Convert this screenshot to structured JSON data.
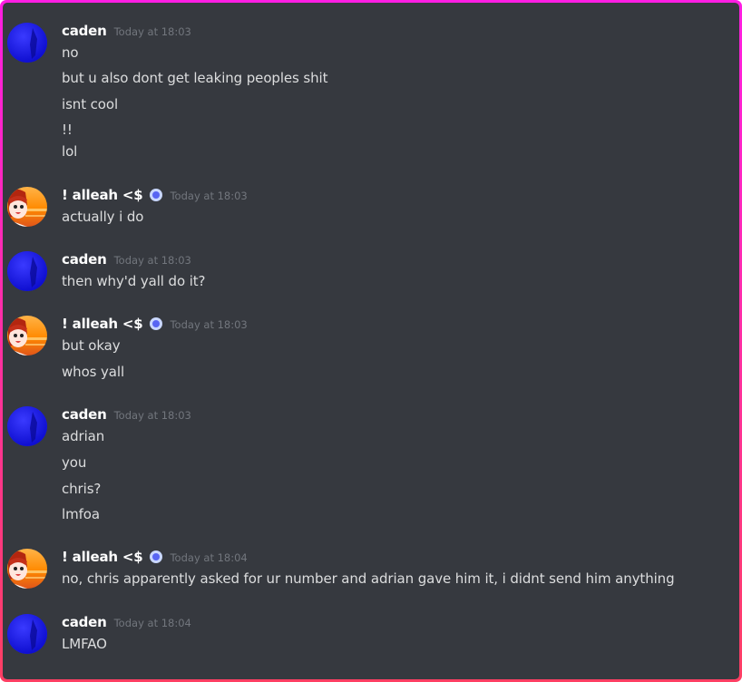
{
  "messages": [
    {
      "author": "caden",
      "timestamp": "Today at 18:03",
      "avatar": "blue-avatar",
      "lines": [
        "no",
        "but u also dont get leaking peoples shit",
        "isnt cool",
        "!!",
        "lol"
      ]
    },
    {
      "author": "! alleah <$",
      "timestamp": "Today at 18:03",
      "avatar": "anime-avatar",
      "badge": "status-badge-icon",
      "lines": [
        "actually i do"
      ]
    },
    {
      "author": "caden",
      "timestamp": "Today at 18:03",
      "avatar": "blue-avatar",
      "lines": [
        "then why'd yall do it?"
      ]
    },
    {
      "author": "! alleah <$",
      "timestamp": "Today at 18:03",
      "avatar": "anime-avatar",
      "badge": "status-badge-icon",
      "lines": [
        "but okay",
        "whos yall"
      ]
    },
    {
      "author": "caden",
      "timestamp": "Today at 18:03",
      "avatar": "blue-avatar",
      "lines": [
        "adrian",
        "you",
        "chris?",
        "lmfoa"
      ]
    },
    {
      "author": "! alleah <$",
      "timestamp": "Today at 18:04",
      "avatar": "anime-avatar",
      "badge": "status-badge-icon",
      "lines": [
        "no, chris apparently asked for ur number and adrian gave him it, i didnt send him anything"
      ]
    },
    {
      "author": "caden",
      "timestamp": "Today at 18:04",
      "avatar": "blue-avatar",
      "lines": [
        "LMFAO"
      ]
    }
  ],
  "colors": {
    "background": "#36393f",
    "username": "#ffffff",
    "text": "#dcddde",
    "timestamp": "#72767d",
    "frame_top": "#ff1ee3",
    "frame_bottom": "#ff3f63"
  }
}
